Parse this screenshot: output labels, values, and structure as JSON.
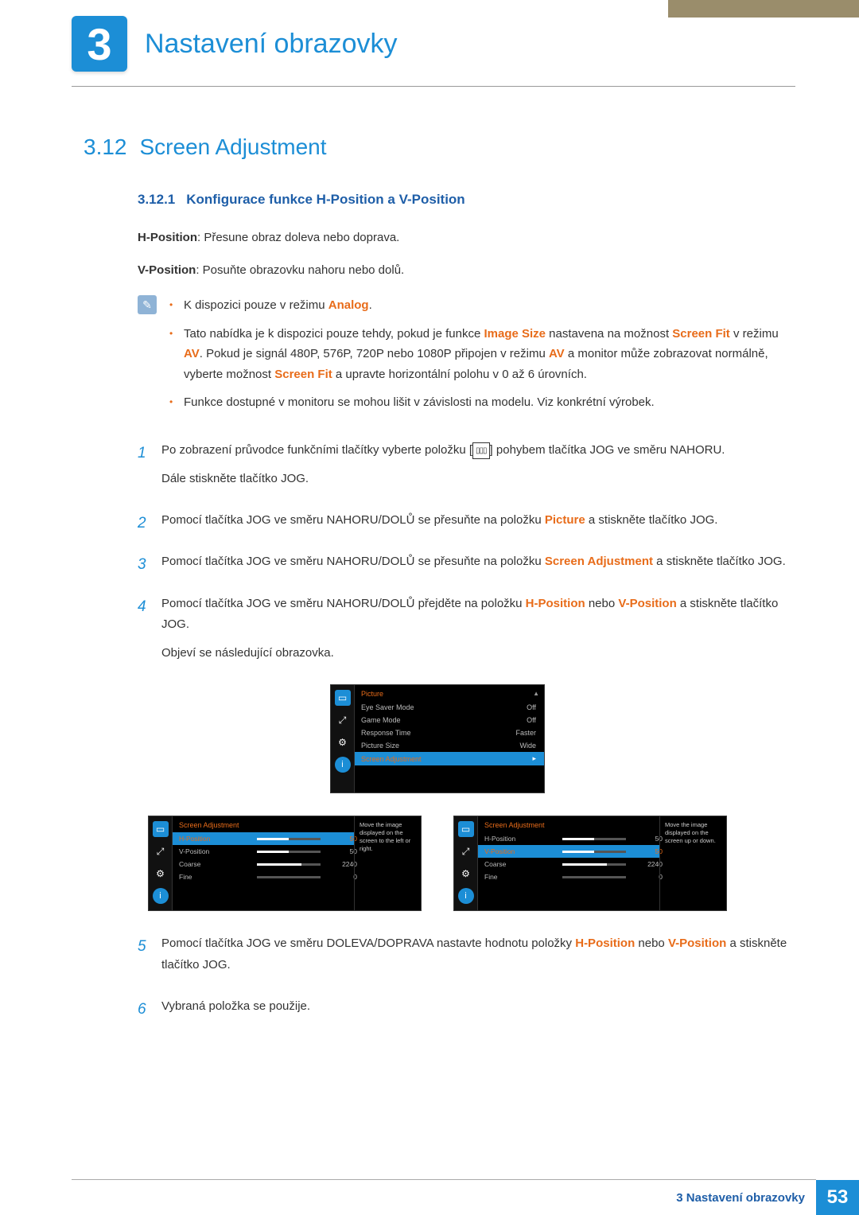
{
  "chapter": {
    "number": "3",
    "title": "Nastavení obrazovky"
  },
  "section": {
    "number": "3.12",
    "title": "Screen Adjustment"
  },
  "subsection": {
    "number": "3.12.1",
    "title": "Konfigurace funkce H-Position a V-Position"
  },
  "desc": {
    "hpos_label": "H-Position",
    "hpos_text": ": Přesune obraz doleva nebo doprava.",
    "vpos_label": "V-Position",
    "vpos_text": ": Posuňte obrazovku nahoru nebo dolů."
  },
  "notes": {
    "n1a": "K dispozici pouze v režimu ",
    "n1b": "Analog",
    "n1c": ".",
    "n2a": "Tato nabídka je k dispozici pouze tehdy, pokud je funkce ",
    "n2b": "Image Size",
    "n2c": " nastavena na možnost ",
    "n2d": "Screen Fit",
    "n2e": " v režimu ",
    "n2f": "AV",
    "n2g": ". Pokud je signál 480P, 576P, 720P nebo 1080P připojen v režimu ",
    "n2h": "AV",
    "n2i": " a monitor může zobrazovat normálně, vyberte možnost ",
    "n2j": "Screen Fit",
    "n2k": " a upravte horizontální polohu v 0 až 6 úrovních.",
    "n3": "Funkce dostupné v monitoru se mohou lišit v závislosti na modelu. Viz konkrétní výrobek."
  },
  "steps": {
    "s1a": "Po zobrazení průvodce funkčními tlačítky vyberte položku [",
    "s1b": "] pohybem tlačítka JOG ve směru NAHORU.",
    "s1c": "Dále stiskněte tlačítko JOG.",
    "s2a": "Pomocí tlačítka JOG ve směru NAHORU/DOLŮ se přesuňte na položku ",
    "s2b": "Picture",
    "s2c": " a stiskněte tlačítko JOG.",
    "s3a": "Pomocí tlačítka JOG ve směru NAHORU/DOLŮ se přesuňte na položku ",
    "s3b": "Screen Adjustment",
    "s3c": " a stiskněte tlačítko JOG.",
    "s4a": "Pomocí tlačítka JOG ve směru NAHORU/DOLŮ přejděte na položku ",
    "s4b": "H-Position",
    "s4c": " nebo ",
    "s4d": "V-Position",
    "s4e": " a stiskněte tlačítko JOG.",
    "s4f": "Objeví se následující obrazovka.",
    "s5a": "Pomocí tlačítka JOG ve směru DOLEVA/DOPRAVA nastavte hodnotu položky ",
    "s5b": "H-Position",
    "s5c": " nebo ",
    "s5d": "V-Position",
    "s5e": " a stiskněte tlačítko JOG.",
    "s6": "Vybraná položka se použije.",
    "num1": "1",
    "num2": "2",
    "num3": "3",
    "num4": "4",
    "num5": "5",
    "num6": "6"
  },
  "osd1": {
    "title": "Picture",
    "items": [
      {
        "label": "Eye Saver Mode",
        "value": "Off"
      },
      {
        "label": "Game Mode",
        "value": "Off"
      },
      {
        "label": "Response Time",
        "value": "Faster"
      },
      {
        "label": "Picture Size",
        "value": "Wide"
      },
      {
        "label": "Screen Adjustment",
        "value": ""
      }
    ]
  },
  "osd2": {
    "title": "Screen Adjustment",
    "tooltip": "Move the image displayed on the screen to the left or right.",
    "items": [
      {
        "label": "H-Position",
        "value": "50",
        "fill": 50
      },
      {
        "label": "V-Position",
        "value": "50",
        "fill": 50
      },
      {
        "label": "Coarse",
        "value": "2240",
        "fill": 70
      },
      {
        "label": "Fine",
        "value": "0",
        "fill": 0
      }
    ]
  },
  "osd3": {
    "title": "Screen Adjustment",
    "tooltip": "Move the image displayed on the screen up or down.",
    "items": [
      {
        "label": "H-Position",
        "value": "50",
        "fill": 50
      },
      {
        "label": "V-Position",
        "value": "50",
        "fill": 50
      },
      {
        "label": "Coarse",
        "value": "2240",
        "fill": 70
      },
      {
        "label": "Fine",
        "value": "0",
        "fill": 0
      }
    ]
  },
  "footer": {
    "text": "3 Nastavení obrazovky",
    "page": "53"
  }
}
